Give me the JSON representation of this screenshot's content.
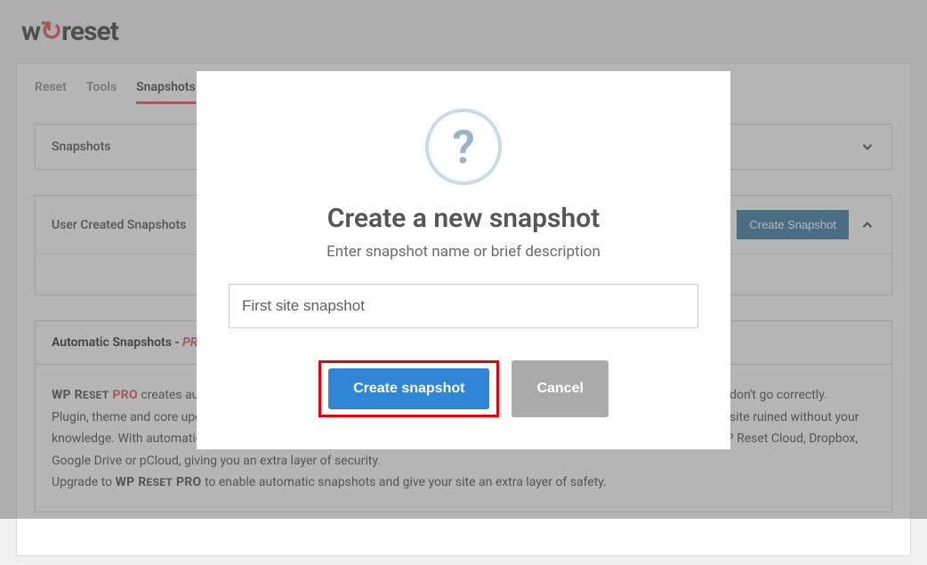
{
  "logo": {
    "prefix": "w",
    "accent": "↻",
    "suffix": "reset"
  },
  "tabs": [
    {
      "label": "Reset",
      "active": false
    },
    {
      "label": "Tools",
      "active": false
    },
    {
      "label": "Snapshots",
      "active": true
    }
  ],
  "panels": {
    "snapshots": {
      "title": "Snapshots"
    },
    "user": {
      "title": "User Created Snapshots",
      "create_button": "Create Snapshot"
    },
    "auto": {
      "title_prefix": "Automatic Snapshots - ",
      "title_suffix": "PRO",
      "body_prefix_strong": "WP Reset PRO",
      "body_line1": " creates automatic snapshots before plugin/theme updates, which helps recover a site if update processes don't go correctly.",
      "body_line2": "Plugin, theme and core updates ruin sites all the time. Be it a large incompatibility issue or a tiny CSS bug - nobody wants a site ruined without your knowledge. With automatic snapshots you always have a safe, fallback point to revert to. Snapshots can be saved in the WP Reset Cloud, Dropbox, Google Drive or pCloud, giving you an extra layer of security.",
      "body_line3_prefix": "Upgrade to ",
      "body_line3_strong": "WP Reset PRO",
      "body_line3_suffix": " to enable automatic snapshots and give your site an extra layer of safety."
    }
  },
  "modal": {
    "title": "Create a new snapshot",
    "subtitle": "Enter snapshot name or brief description",
    "input_value": "First site snapshot",
    "create_label": "Create snapshot",
    "cancel_label": "Cancel"
  }
}
